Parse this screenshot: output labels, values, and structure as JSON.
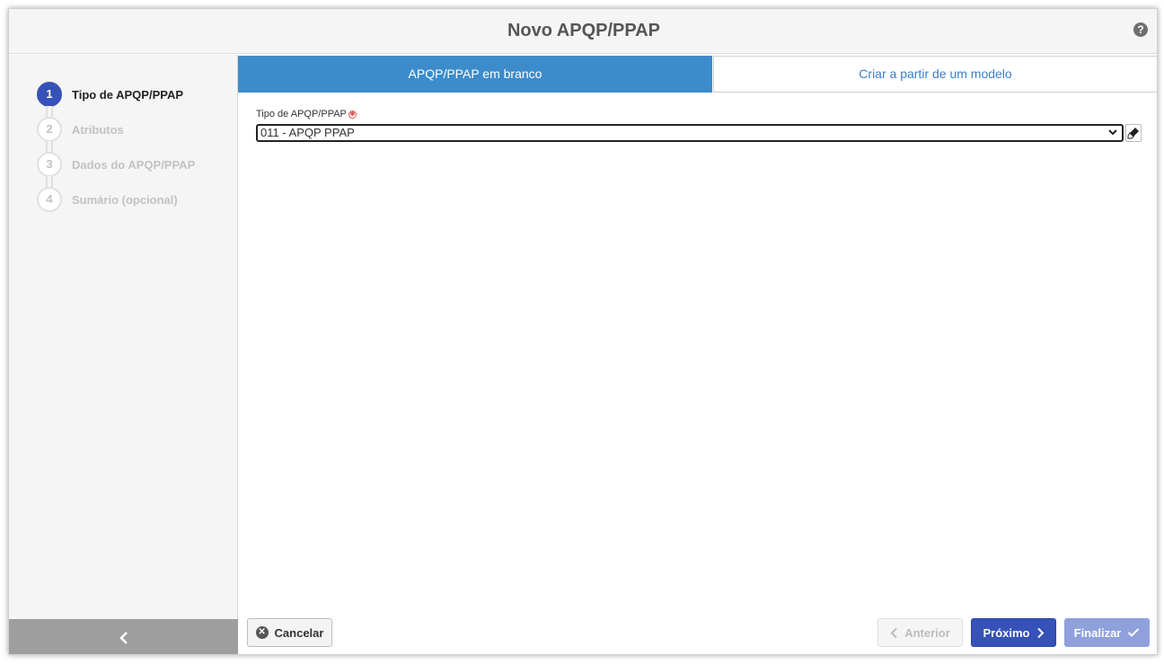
{
  "header": {
    "title": "Novo APQP/PPAP",
    "help_icon": "?"
  },
  "steps": [
    {
      "number": "1",
      "label": "Tipo de APQP/PPAP",
      "state": "active"
    },
    {
      "number": "2",
      "label": "Atributos",
      "state": "inactive"
    },
    {
      "number": "3",
      "label": "Dados do APQP/PPAP",
      "state": "inactive"
    },
    {
      "number": "4",
      "label": "Sumário (opcional)",
      "state": "inactive"
    }
  ],
  "sidebar": {
    "collapse_icon": "chevron-left-icon"
  },
  "tabs": [
    {
      "label": "APQP/PPAP em branco",
      "active": true
    },
    {
      "label": "Criar a partir de um modelo",
      "active": false
    }
  ],
  "form": {
    "type_label": "Tipo de APQP/PPAP",
    "type_value": "011 - APQP PPAP"
  },
  "footer": {
    "cancel_label": "Cancelar",
    "prev_label": "Anterior",
    "next_label": "Próximo",
    "finish_label": "Finalizar"
  },
  "colors": {
    "primary": "#3652b8",
    "tab_active": "#3c8ccc",
    "link": "#3c7ec4",
    "required": "#d9534f"
  }
}
